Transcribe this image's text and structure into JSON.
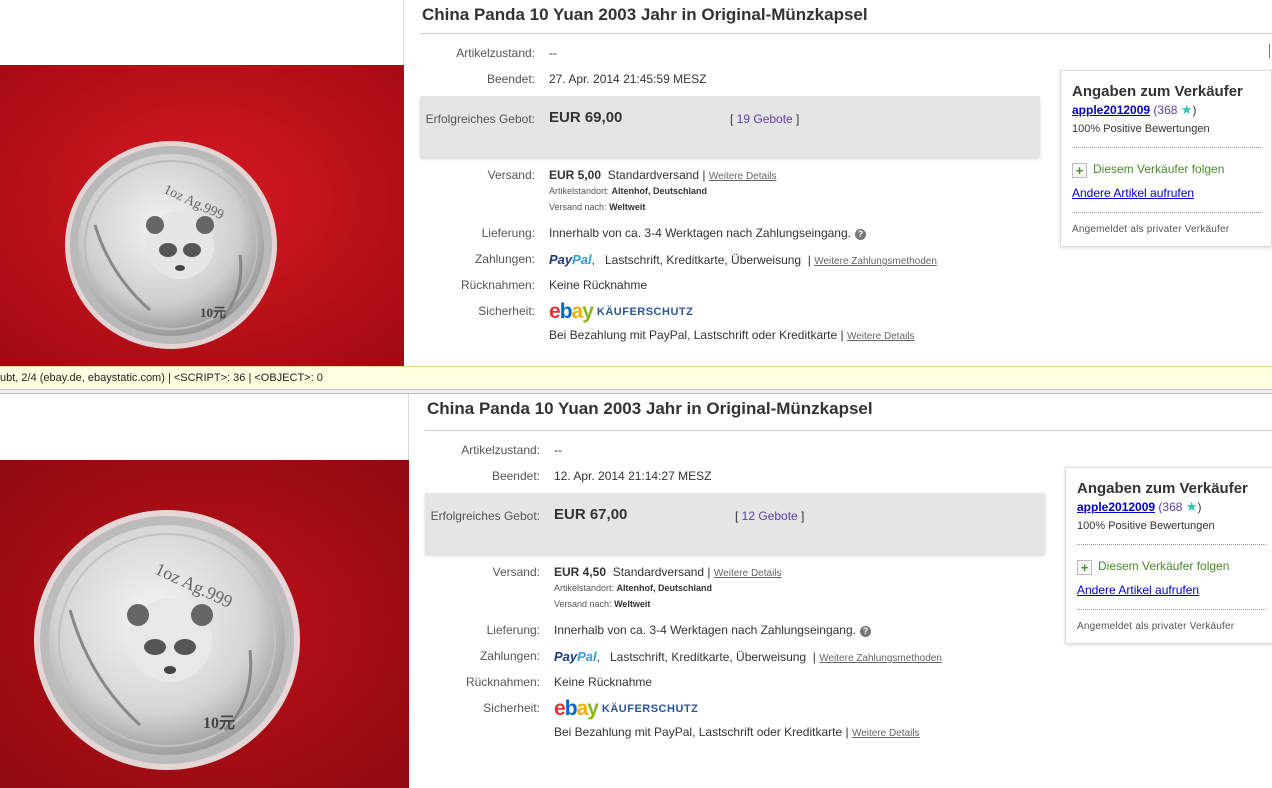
{
  "listings": [
    {
      "title": "China Panda 10 Yuan 2003 Jahr in Original-Münzkapsel",
      "condition_label": "Artikelzustand:",
      "condition_value": "--",
      "ended_label": "Beendet:",
      "ended_value": "27. Apr. 2014  21:45:59 MESZ",
      "bid_label": "Erfolgreiches Gebot:",
      "bid_price": "EUR 69,00",
      "bid_count": "19 Gebote",
      "shipping_label": "Versand:",
      "shipping_price": "EUR 5,00",
      "shipping_method": "Standardversand |",
      "shipping_link": "Weitere Details",
      "location_label": "Artikelstandort:",
      "location_value": "Altenhof, Deutschland",
      "ships_to_label": "Versand nach:",
      "ships_to_value": "Weltweit",
      "delivery_label": "Lieferung:",
      "delivery_value": "Innerhalb von ca. 3-4 Werktagen nach Zahlungseingang.",
      "payment_label": "Zahlungen:",
      "payment_paypal_a": "Pay",
      "payment_paypal_b": "Pal",
      "payment_methods": "Lastschrift,  Kreditkarte,  Überweisung",
      "payment_link": "Weitere Zahlungsmethoden",
      "returns_label": "Rücknahmen:",
      "returns_value": "Keine Rücknahme",
      "security_label": "Sicherheit:",
      "ebay_e": "e",
      "ebay_b": "b",
      "ebay_a": "a",
      "ebay_y": "y",
      "kauferschutz": "KÄUFERSCHUTZ",
      "security_note": "Bei Bezahlung mit PayPal, Lastschrift oder Kreditkarte |",
      "security_link": "Weitere Details",
      "seller": {
        "heading": "Angaben zum Verkäufer",
        "username": "apple2012009",
        "score_open": "(",
        "score": "368",
        "score_close": ")",
        "positive": "100% Positive Bewertungen",
        "follow": "Diesem Verkäufer folgen",
        "other_items": "Andere Artikel aufrufen",
        "private": "Angemeldet als privater Verkäufer"
      }
    },
    {
      "title": "China Panda 10 Yuan 2003 Jahr in Original-Münzkapsel",
      "condition_label": "Artikelzustand:",
      "condition_value": "--",
      "ended_label": "Beendet:",
      "ended_value": "12. Apr. 2014  21:14:27 MESZ",
      "bid_label": "Erfolgreiches Gebot:",
      "bid_price": "EUR 67,00",
      "bid_count": "12 Gebote",
      "shipping_label": "Versand:",
      "shipping_price": "EUR 4,50",
      "shipping_method": "Standardversand |",
      "shipping_link": "Weitere Details",
      "location_label": "Artikelstandort:",
      "location_value": "Altenhof, Deutschland",
      "ships_to_label": "Versand nach:",
      "ships_to_value": "Weltweit",
      "delivery_label": "Lieferung:",
      "delivery_value": "Innerhalb von ca. 3-4 Werktagen nach Zahlungseingang.",
      "payment_label": "Zahlungen:",
      "payment_paypal_a": "Pay",
      "payment_paypal_b": "Pal",
      "payment_methods": "Lastschrift,  Kreditkarte,  Überweisung",
      "payment_link": "Weitere Zahlungsmethoden",
      "returns_label": "Rücknahmen:",
      "returns_value": "Keine Rücknahme",
      "security_label": "Sicherheit:",
      "ebay_e": "e",
      "ebay_b": "b",
      "ebay_a": "a",
      "ebay_y": "y",
      "kauferschutz": "KÄUFERSCHUTZ",
      "security_note": "Bei Bezahlung mit PayPal, Lastschrift oder Kreditkarte |",
      "security_link": "Weitere Details",
      "seller": {
        "heading": "Angaben zum Verkäufer",
        "username": "apple2012009",
        "score_open": "(",
        "score": "368",
        "score_close": ")",
        "positive": "100% Positive Bewertungen",
        "follow": "Diesem Verkäufer folgen",
        "other_items": "Andere Artikel aufrufen",
        "private": "Angemeldet als privater Verkäufer"
      }
    }
  ],
  "statusbar": {
    "text": "ubt, 2/4 (ebay.de, ebaystatic.com) | <SCRIPT>: 36 | <OBJECT>: 0"
  },
  "coin": {
    "top_text": "1oz Ag.999",
    "value_text": "10元"
  },
  "colors": {
    "background_red": "#c8101a",
    "link_blue": "#0000cc",
    "bid_purple": "#5d3fa5",
    "follow_green": "#4a8a28",
    "status_yellow": "#ffffe1"
  }
}
